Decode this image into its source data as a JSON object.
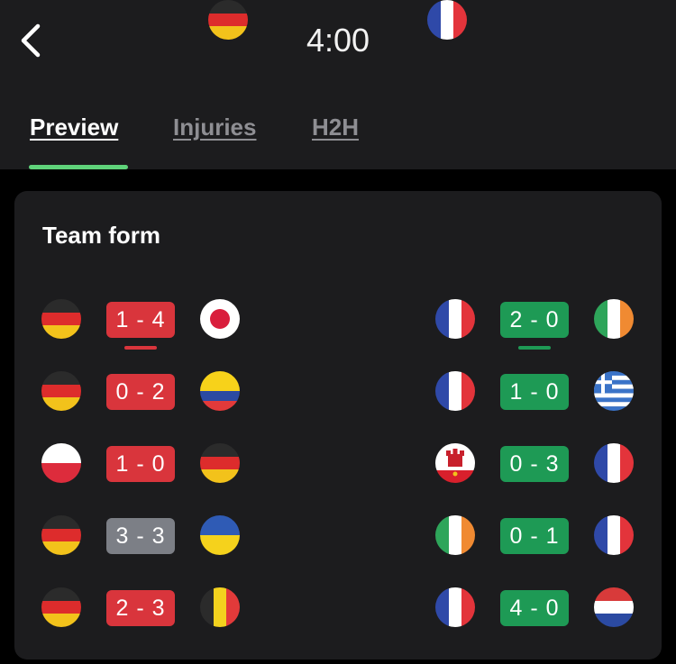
{
  "header": {
    "time": "4:00",
    "home_flag": "germany-flag-icon",
    "away_flag": "france-flag-icon",
    "back_icon": "chevron-left-icon"
  },
  "tabs": [
    {
      "label": "Preview",
      "active": true
    },
    {
      "label": "Injuries",
      "active": false
    },
    {
      "label": "H2H",
      "active": false
    }
  ],
  "team_form": {
    "title": "Team form",
    "home_matches": [
      {
        "home": "germany",
        "score": "1 - 4",
        "away": "japan",
        "result": "loss",
        "highlight": true
      },
      {
        "home": "germany",
        "score": "0 - 2",
        "away": "colombia",
        "result": "loss",
        "highlight": false
      },
      {
        "home": "poland",
        "score": "1 - 0",
        "away": "germany",
        "result": "loss",
        "highlight": false
      },
      {
        "home": "germany",
        "score": "3 - 3",
        "away": "ukraine",
        "result": "draw",
        "highlight": false
      },
      {
        "home": "germany",
        "score": "2 - 3",
        "away": "belgium",
        "result": "loss",
        "highlight": false
      }
    ],
    "away_matches": [
      {
        "home": "france",
        "score": "2 - 0",
        "away": "ireland",
        "result": "win",
        "highlight": true
      },
      {
        "home": "france",
        "score": "1 - 0",
        "away": "greece",
        "result": "win",
        "highlight": false
      },
      {
        "home": "gibraltar",
        "score": "0 - 3",
        "away": "france",
        "result": "win",
        "highlight": false
      },
      {
        "home": "ireland",
        "score": "0 - 1",
        "away": "france",
        "result": "win",
        "highlight": false
      },
      {
        "home": "france",
        "score": "4 - 0",
        "away": "netherlands",
        "result": "win",
        "highlight": false
      }
    ]
  },
  "colors": {
    "loss": "#d9353c",
    "draw": "#7c7f86",
    "win": "#1e9a55",
    "accent": "#5fd37a"
  }
}
